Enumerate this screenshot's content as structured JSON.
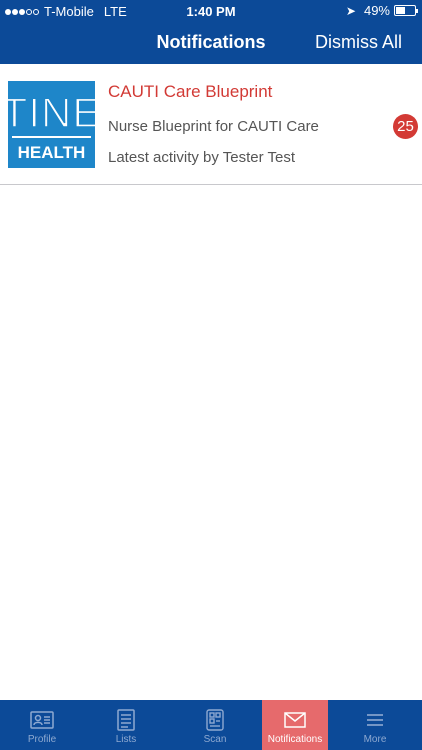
{
  "status_bar": {
    "carrier": "T-Mobile",
    "network": "LTE",
    "time": "1:40 PM",
    "battery_percent": "49%",
    "battery_level": 0.49,
    "signal_bars_filled": 3,
    "signal_bars_total": 5
  },
  "nav": {
    "title": "Notifications",
    "dismiss_label": "Dismiss All"
  },
  "notifications": [
    {
      "logo_line1": "TINE",
      "logo_line2": "HEALTH",
      "title": "CAUTI Care Blueprint",
      "subtitle": "Nurse Blueprint for CAUTI Care",
      "activity": "Latest activity by Tester Test",
      "badge_count": "25"
    }
  ],
  "tabs": [
    {
      "label": "Profile",
      "icon": "profile-card-icon"
    },
    {
      "label": "Lists",
      "icon": "list-icon"
    },
    {
      "label": "Scan",
      "icon": "scan-icon"
    },
    {
      "label": "Notifications",
      "icon": "envelope-icon",
      "active": true
    },
    {
      "label": "More",
      "icon": "menu-icon"
    }
  ],
  "colors": {
    "brand_blue": "#0c4a98",
    "accent_red": "#d23a35",
    "active_tab": "#e66a6c",
    "logo_blue": "#1e86c9"
  }
}
